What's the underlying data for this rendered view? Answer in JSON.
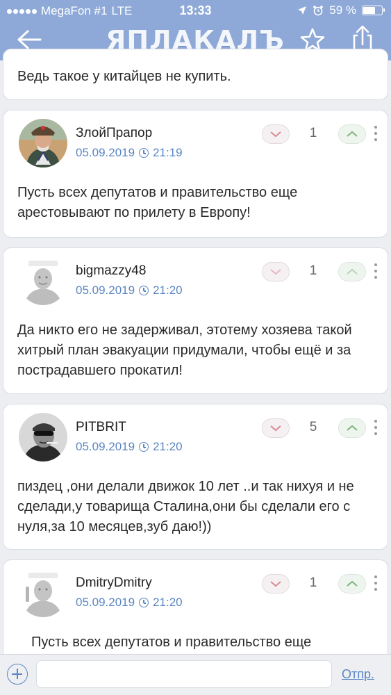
{
  "status": {
    "carrier": "MegaFon #1",
    "network": "LTE",
    "time": "13:33",
    "battery": "59 %",
    "battery_level": 0.59
  },
  "header": {
    "logo": "ЯПЛАКАЛЪ",
    "icons": [
      "back-arrow-icon",
      "star-icon",
      "share-icon"
    ]
  },
  "top_fragment": {
    "text": "Ведь такое у китайцев не купить."
  },
  "comments": [
    {
      "username": "ЗлойПрапор",
      "date": "05.09.2019",
      "time": "21:19",
      "score": "1",
      "text": "Пусть всех депутатов и правительство еще арестовывают по прилету в Европу!"
    },
    {
      "username": "bigmazzy48",
      "date": "05.09.2019",
      "time": "21:20",
      "score": "1",
      "text": "Да никто его не задерживал, этотему хозяева такой хитрый план эвакуации придумали, чтобы ещё и за пострадавшего прокатил!"
    },
    {
      "username": "PITBRIT",
      "date": "05.09.2019",
      "time": "21:20",
      "score": "5",
      "text": "пиздец ,они делали движок 10 лет ..и так нихуя и не сделади,у товарища Сталина,они бы сделали его с нуля,за 10 месяцев,зуб даю!))"
    },
    {
      "username": "DmitryDmitry",
      "date": "05.09.2019",
      "time": "21:20",
      "score": "1",
      "text": "Пусть всех депутатов и правительство еще"
    }
  ],
  "composer": {
    "input_value": "",
    "send_label": "Отпр."
  },
  "colors": {
    "header": "#8ea9d8",
    "accent": "#5a86c4",
    "vote_down": "#d98a96",
    "vote_up": "#7cb77c"
  }
}
